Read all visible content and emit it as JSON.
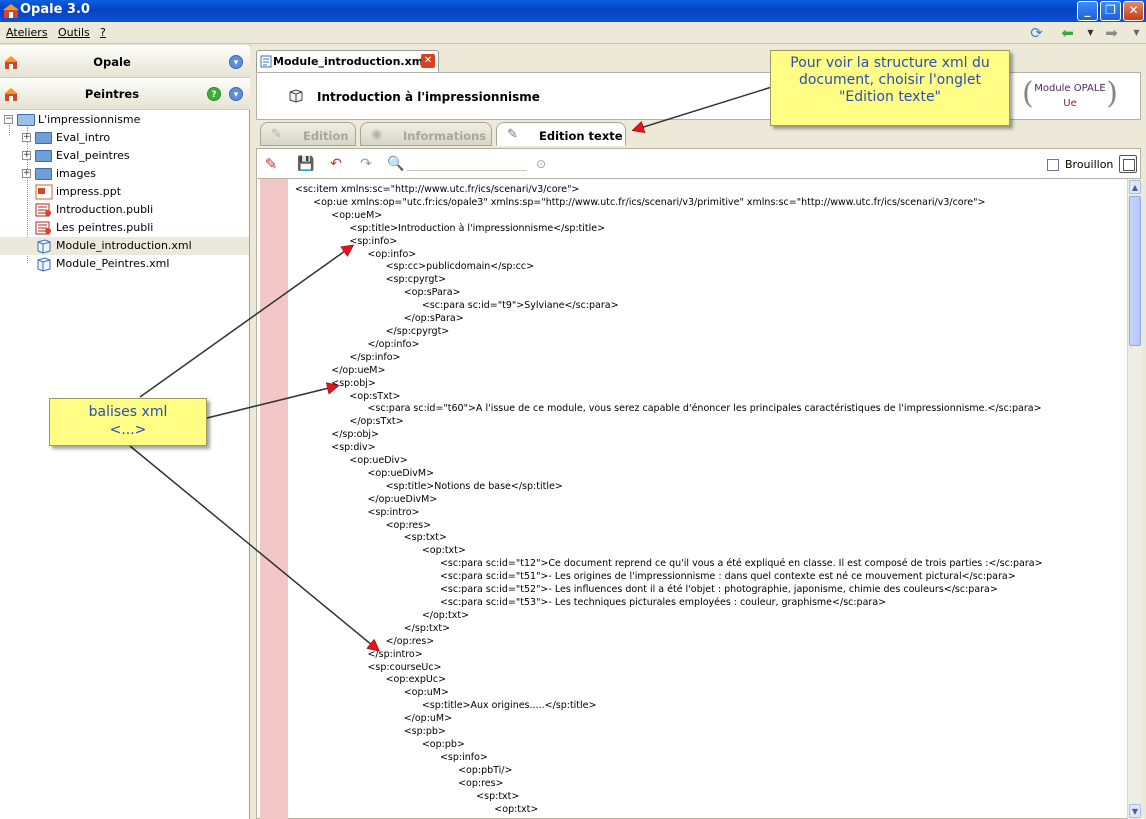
{
  "window": {
    "title": "Opale 3.0"
  },
  "menu": {
    "items": [
      "Ateliers",
      "Outils",
      "?"
    ]
  },
  "left_panel": {
    "workshops": [
      {
        "label": "Opale"
      },
      {
        "label": "Peintres"
      }
    ],
    "tree": [
      {
        "label": "L'impressionnisme",
        "type": "folder-open"
      },
      {
        "label": "Eval_intro",
        "type": "folder"
      },
      {
        "label": "Eval_peintres",
        "type": "folder"
      },
      {
        "label": "images",
        "type": "folder"
      },
      {
        "label": "impress.ppt",
        "type": "ppt"
      },
      {
        "label": "Introduction.publi",
        "type": "publi"
      },
      {
        "label": "Les peintres.publi",
        "type": "publi"
      },
      {
        "label": "Module_introduction.xml",
        "type": "xml",
        "selected": true
      },
      {
        "label": "Module_Peintres.xml",
        "type": "xml"
      }
    ]
  },
  "editor": {
    "tab_label": "Module_introduction.xml",
    "header_title": "Introduction à l'impressionnisme",
    "module_badge": {
      "line1": "Module OPALE",
      "line2": "Ue"
    },
    "subtabs": [
      {
        "label": "Edition",
        "active": false
      },
      {
        "label": "Informations",
        "active": false
      },
      {
        "label": "Edition texte",
        "active": true
      }
    ],
    "toolbar": {
      "checkbox_label": "Brouillon"
    },
    "code_lines": [
      "<sc:item xmlns:sc=\"http://www.utc.fr/ics/scenari/v3/core\">",
      "      <op:ue xmlns:op=\"utc.fr:ics/opale3\" xmlns:sp=\"http://www.utc.fr/ics/scenari/v3/primitive\" xmlns:sc=\"http://www.utc.fr/ics/scenari/v3/core\">",
      "            <op:ueM>",
      "                  <sp:title>Introduction à l'impressionnisme</sp:title>",
      "                  <sp:info>",
      "                        <op:info>",
      "                              <sp:cc>publicdomain</sp:cc>",
      "                              <sp:cpyrgt>",
      "                                    <op:sPara>",
      "                                          <sc:para sc:id=\"t9\">Sylviane</sc:para>",
      "                                    </op:sPara>",
      "                              </sp:cpyrgt>",
      "                        </op:info>",
      "                  </sp:info>",
      "            </op:ueM>",
      "            <sp:obj>",
      "                  <op:sTxt>",
      "                        <sc:para sc:id=\"t60\">A l'issue de ce module, vous serez capable d'énoncer les principales caractéristiques de l'impressionnisme.</sc:para>",
      "                  </op:sTxt>",
      "            </sp:obj>",
      "            <sp:div>",
      "                  <op:ueDiv>",
      "                        <op:ueDivM>",
      "                              <sp:title>Notions de base</sp:title>",
      "                        </op:ueDivM>",
      "                        <sp:intro>",
      "                              <op:res>",
      "                                    <sp:txt>",
      "                                          <op:txt>",
      "                                                <sc:para sc:id=\"t12\">Ce document reprend ce qu'il vous a été expliqué en classe. Il est composé de trois parties :</sc:para>",
      "                                                <sc:para sc:id=\"t51\">- Les origines de l'impressionnisme : dans quel contexte est né ce mouvement pictural</sc:para>",
      "                                                <sc:para sc:id=\"t52\">- Les influences dont il a été l'objet : photographie, japonisme, chimie des couleurs</sc:para>",
      "                                                <sc:para sc:id=\"t53\">- Les techniques picturales employées : couleur, graphisme</sc:para>",
      "                                          </op:txt>",
      "                                    </sp:txt>",
      "                              </op:res>",
      "                        </sp:intro>",
      "                        <sp:courseUc>",
      "                              <op:expUc>",
      "                                    <op:uM>",
      "                                          <sp:title>Aux origines.....</sp:title>",
      "                                    </op:uM>",
      "                                    <sp:pb>",
      "                                          <op:pb>",
      "                                                <sp:info>",
      "                                                      <op:pbTi/>",
      "                                                      <op:res>",
      "                                                            <sp:txt>",
      "                                                                  <op:txt>"
    ]
  },
  "annotations": {
    "callout_top": [
      "Pour voir la structure xml du",
      "document, choisir l'onglet",
      "\"Edition texte\""
    ],
    "callout_left": [
      "balises xml",
      "<...>"
    ]
  },
  "colors": {
    "titlebar": "#0842c4",
    "gutter": "#f3c7c7",
    "callout_bg": "#fffd83",
    "callout_text": "#2a4fb5",
    "arrow_head": "#e8141c"
  }
}
